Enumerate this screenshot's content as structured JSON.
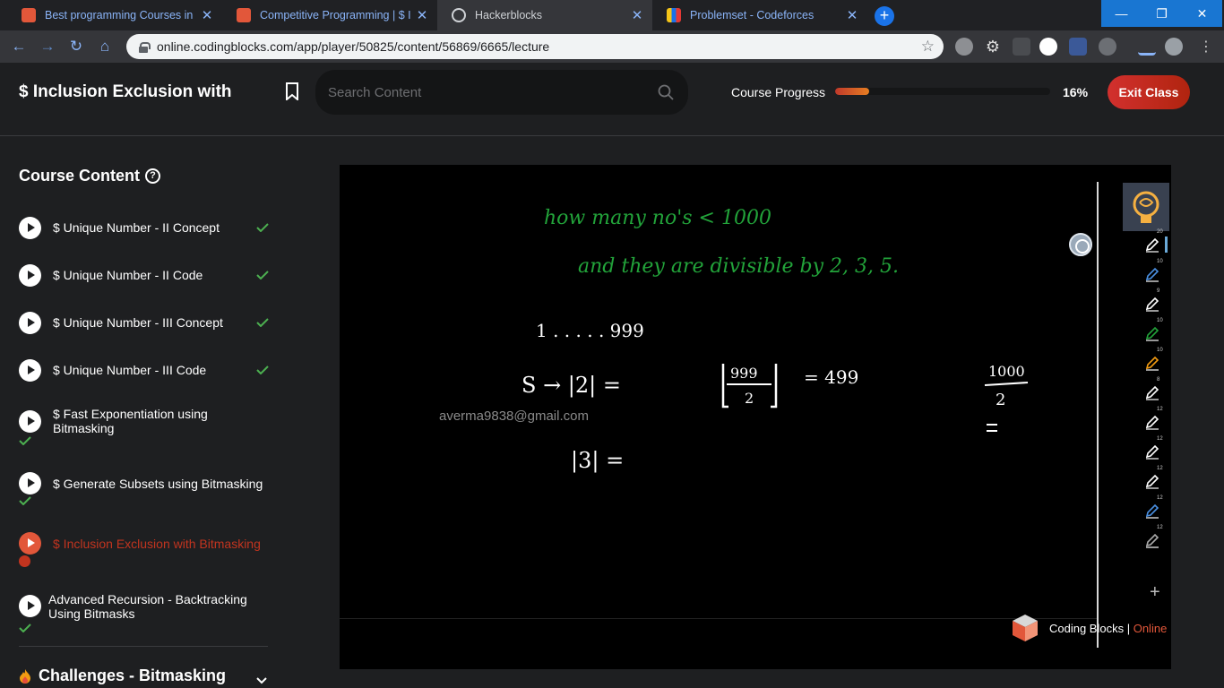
{
  "browser": {
    "tabs": [
      {
        "title": "Best programming Courses in De",
        "favicon_color": "#e2573a",
        "active": false
      },
      {
        "title": "Competitive Programming | $ Inc",
        "favicon_color": "#e2573a",
        "active": false
      },
      {
        "title": "Hackerblocks",
        "favicon_color": "#ffffff",
        "active": true
      },
      {
        "title": "Problemset - Codeforces",
        "favicon_color": "#f5c518",
        "active": false
      }
    ],
    "url": "online.codingblocks.com/app/player/50825/content/56869/6665/lecture",
    "window_buttons": {
      "minimize": "—",
      "restore": "❐",
      "close": "✕"
    }
  },
  "header": {
    "course_title": "$ Inclusion Exclusion with",
    "search_placeholder": "Search Content",
    "progress_label": "Course Progress",
    "progress_fraction": 0.16,
    "progress_text": "16%",
    "exit_label": "Exit Class"
  },
  "sidebar": {
    "title": "Course Content",
    "help_glyph": "?",
    "items": [
      {
        "label": "$ Unique Number - II Concept",
        "done": true
      },
      {
        "label": "$ Unique Number - II Code",
        "done": true
      },
      {
        "label": "$ Unique Number - III Concept",
        "done": true
      },
      {
        "label": "$ Unique Number - III Code",
        "done": true
      },
      {
        "label": "$ Fast Exponentiation using Bitmasking",
        "done": true
      },
      {
        "label": "$ Generate Subsets using Bitmasking",
        "done": true
      },
      {
        "label": "$ Inclusion Exclusion with Bitmasking",
        "done": false,
        "active": true
      },
      {
        "label": "Advanced Recursion - Backtracking Using Bitmasks",
        "done": true
      }
    ],
    "section": "Challenges - Bitmasking"
  },
  "player": {
    "watermark": "averma9838@gmail.com",
    "board_lines": [
      "how many no's < 1000",
      "and they are divisible by 2, 3, 5.",
      "1 . . . . . 999",
      "S → |2|  =",
      "= 499",
      "|3|  ="
    ],
    "board_fraction_left": {
      "num": "999",
      "den": "2"
    },
    "board_fraction_right": {
      "num": "1000",
      "den": "2"
    },
    "pen_sizes": [
      "20",
      "10",
      "9",
      "10",
      "10",
      "8",
      "12",
      "12",
      "12",
      "12",
      "12"
    ],
    "logo_text": "Coding Blocks",
    "logo_online": "Online",
    "logo_sep": " | "
  },
  "colors": {
    "accent": "#e2573a",
    "check": "#4caf50",
    "board_green": "#22a33a"
  }
}
